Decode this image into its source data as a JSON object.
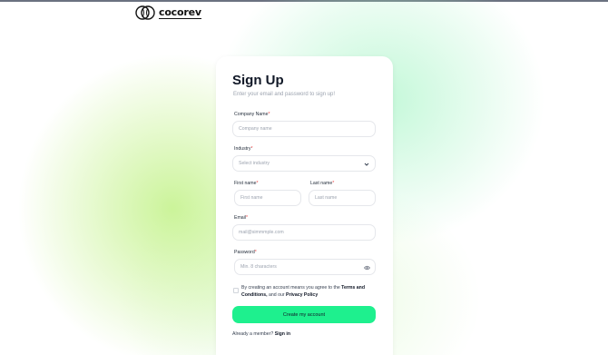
{
  "brand": {
    "name": "cocorev"
  },
  "form": {
    "title": "Sign Up",
    "subtitle": "Enter your email and password to sign up!",
    "company": {
      "label": "Company Name",
      "required_mark": "*",
      "placeholder": "Company name"
    },
    "industry": {
      "label": "Industry",
      "required_mark": "*",
      "placeholder": "Select industry",
      "icon": "chevron-down-icon"
    },
    "first_name": {
      "label": "First name",
      "required_mark": "*",
      "placeholder": "First name"
    },
    "last_name": {
      "label": "Last name",
      "required_mark": "*",
      "placeholder": "Last name"
    },
    "email": {
      "label": "Email",
      "required_mark": "*",
      "placeholder": "mail@simmmple.com"
    },
    "password": {
      "label": "Password",
      "required_mark": "*",
      "placeholder": "Min. 8 characters",
      "icon": "eye-icon"
    },
    "terms": {
      "prefix": "By creating an account means you agree to the ",
      "terms_link": "Terms and Conditions,",
      "middle": " and our ",
      "privacy_link": "Privacy Policy",
      "checked": false
    },
    "submit_label": "Create my account",
    "signin_prompt": "Already a member?",
    "signin_link": "Sign in"
  },
  "colors": {
    "accent": "#1ef08e",
    "required": "#ef4444",
    "glow_green": "#baf078",
    "glow_mint": "#aaf5c8"
  }
}
